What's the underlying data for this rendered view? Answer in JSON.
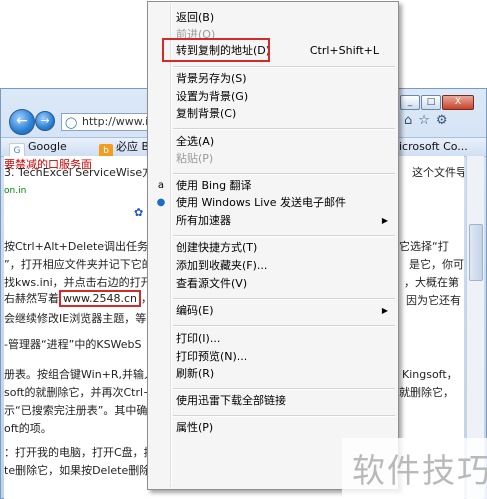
{
  "browser": {
    "address": "http://www.iefa",
    "tabs": [
      {
        "label": "Google",
        "icon": "google-icon"
      },
      {
        "label": "必应 Bi",
        "icon": "bing-icon"
      },
      {
        "label": "icrosoft Co...",
        "icon": "microsoft-icon"
      }
    ],
    "window_buttons": [
      "_",
      "□",
      "X"
    ]
  },
  "page": {
    "lines": [
      {
        "text": "要禁减的口服务面"
      },
      {
        "text": "3. TechExcel ServiceWise方",
        "extra": "这个文件导致"
      },
      {
        "text": "on.in"
      },
      {
        "text": "按Ctrl+Alt+Delete调出任务管理",
        "extra": "它选择“打"
      },
      {
        "text": "”，打开相应文件夹并记下它的",
        "extra": "是它，你可"
      },
      {
        "text": "找kws.ini，并点击右边的打开",
        "extra": "，大概在第"
      },
      {
        "text_before": "右赫然写着",
        "url": "www.2548.cn",
        "text_after": "，是",
        "extra": "因为它还有"
      },
      {
        "text": "会继续修改IE浏览器主题，等出"
      },
      {
        "text": "-管理器“进程”中的KSWebS"
      },
      {
        "text": "册表。按组合键Win+R,并输入re",
        "extra": "Kingsoft，"
      },
      {
        "text": "soft的就删除它，并再次Ctrl+F",
        "extra": "的就删除它，"
      },
      {
        "text": "示“已搜索完注册表”。其中确"
      },
      {
        "text": "oft的项。"
      },
      {
        "text": "：打开我的电脑，打开C盘，按Ctrl+F查找，输入Kingsoft搜索。选中查"
      },
      {
        "text": "te删除它，如果按Delete删除那么请清空回收站。再查找一遍，没了。"
      }
    ]
  },
  "menu": {
    "items": [
      {
        "label": "返回(B)",
        "disabled": false
      },
      {
        "label": "前进(O)",
        "disabled": true
      },
      {
        "label": "转到复制的地址(D)",
        "shortcut": "Ctrl+Shift+L",
        "disabled": false
      },
      {
        "label": "背景另存为(S)",
        "disabled": false
      },
      {
        "label": "设置为背景(G)",
        "disabled": false
      },
      {
        "label": "复制背景(C)",
        "disabled": false
      },
      {
        "label": "全选(A)",
        "disabled": false
      },
      {
        "label": "粘贴(P)",
        "disabled": true
      },
      {
        "label": "使用 Bing 翻译",
        "disabled": false
      },
      {
        "label": "使用 Windows Live 发送电子邮件",
        "disabled": false
      },
      {
        "label": "所有加速器",
        "disabled": false
      },
      {
        "label": "创建快捷方式(T)",
        "disabled": false
      },
      {
        "label": "添加到收藏夹(F)...",
        "disabled": false
      },
      {
        "label": "查看源文件(V)",
        "disabled": false
      },
      {
        "label": "编码(E)",
        "disabled": false
      },
      {
        "label": "打印(I)...",
        "disabled": false
      },
      {
        "label": "打印预览(N)...",
        "disabled": false
      },
      {
        "label": "刷新(R)",
        "disabled": false
      },
      {
        "label": "使用迅雷下载全部链接",
        "disabled": false
      },
      {
        "label": "属性(P)",
        "disabled": false
      }
    ]
  },
  "watermark": "软件技巧",
  "colors": {
    "highlight": "#d42a2a",
    "menu_bg": "#f5f5f5"
  }
}
